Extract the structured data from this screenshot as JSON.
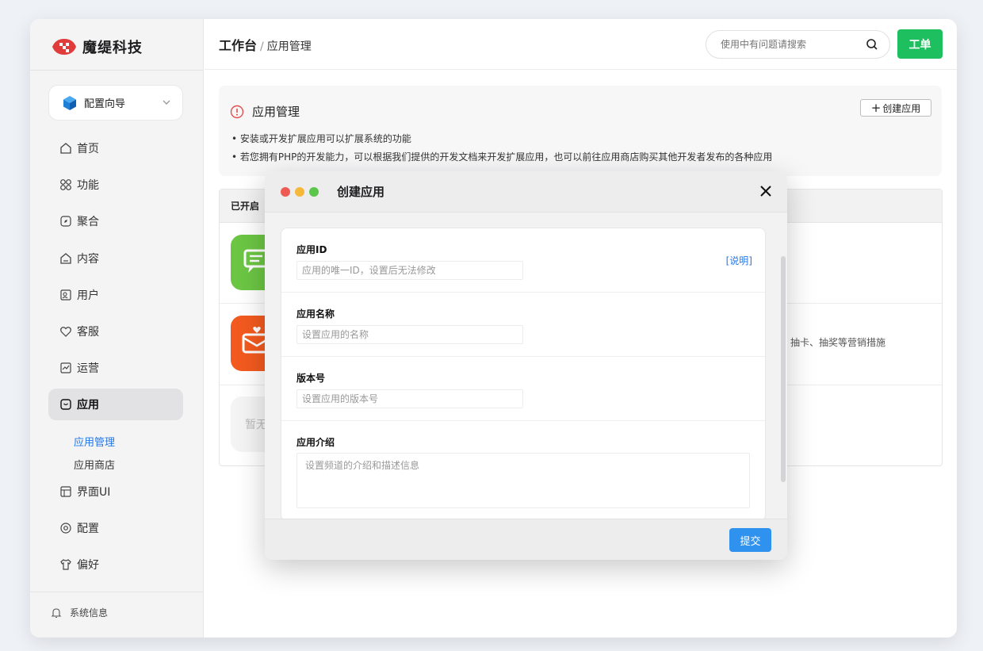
{
  "brand": {
    "name": "魔缇科技"
  },
  "sidebar": {
    "wizard_label": "配置向导",
    "items": [
      {
        "label": "首页",
        "icon": "home-icon"
      },
      {
        "label": "功能",
        "icon": "grid-icon"
      },
      {
        "label": "聚合",
        "icon": "compass-icon"
      },
      {
        "label": "内容",
        "icon": "content-icon"
      },
      {
        "label": "用户",
        "icon": "user-card-icon"
      },
      {
        "label": "客服",
        "icon": "heart-icon"
      },
      {
        "label": "运营",
        "icon": "chart-icon"
      },
      {
        "label": "应用",
        "icon": "app-icon",
        "active": true
      },
      {
        "label": "界面UI",
        "icon": "layout-icon"
      },
      {
        "label": "配置",
        "icon": "settings-icon"
      },
      {
        "label": "偏好",
        "icon": "shirt-icon"
      }
    ],
    "subitems": [
      "应用管理",
      "应用商店"
    ],
    "system_info": "系统信息"
  },
  "header": {
    "title": "工作台",
    "crumb": "应用管理",
    "search_placeholder": "使用中有问题请搜索",
    "ticket_label": "工单"
  },
  "info": {
    "title": "应用管理",
    "create_label": "创建应用",
    "bullets": [
      "安装或开发扩展应用可以扩展系统的功能",
      "若您拥有PHP的开发能力，可以根据我们提供的开发文档来开发扩展应用，也可以前往应用商店购买其他开发者发布的各种应用"
    ]
  },
  "table": {
    "header_label": "已开启",
    "row2_desc": "、抽卡、抽奖等营销措施",
    "row3_label": "暂无"
  },
  "modal": {
    "title": "创建应用",
    "fields": [
      {
        "label": "应用ID",
        "placeholder": "应用的唯一ID，设置后无法修改",
        "link": "[说明]"
      },
      {
        "label": "应用名称",
        "placeholder": "设置应用的名称"
      },
      {
        "label": "版本号",
        "placeholder": "设置应用的版本号"
      },
      {
        "label": "应用介绍",
        "placeholder": "设置频道的介绍和描述信息"
      }
    ],
    "submit_label": "提交"
  },
  "colors": {
    "accent_blue": "#2477e6",
    "ticket_green": "#1dbf5e",
    "submit_blue": "#2f92ee",
    "warn_red": "#e34d4d",
    "app_green": "#6cc644",
    "app_orange": "#f35a1f"
  }
}
